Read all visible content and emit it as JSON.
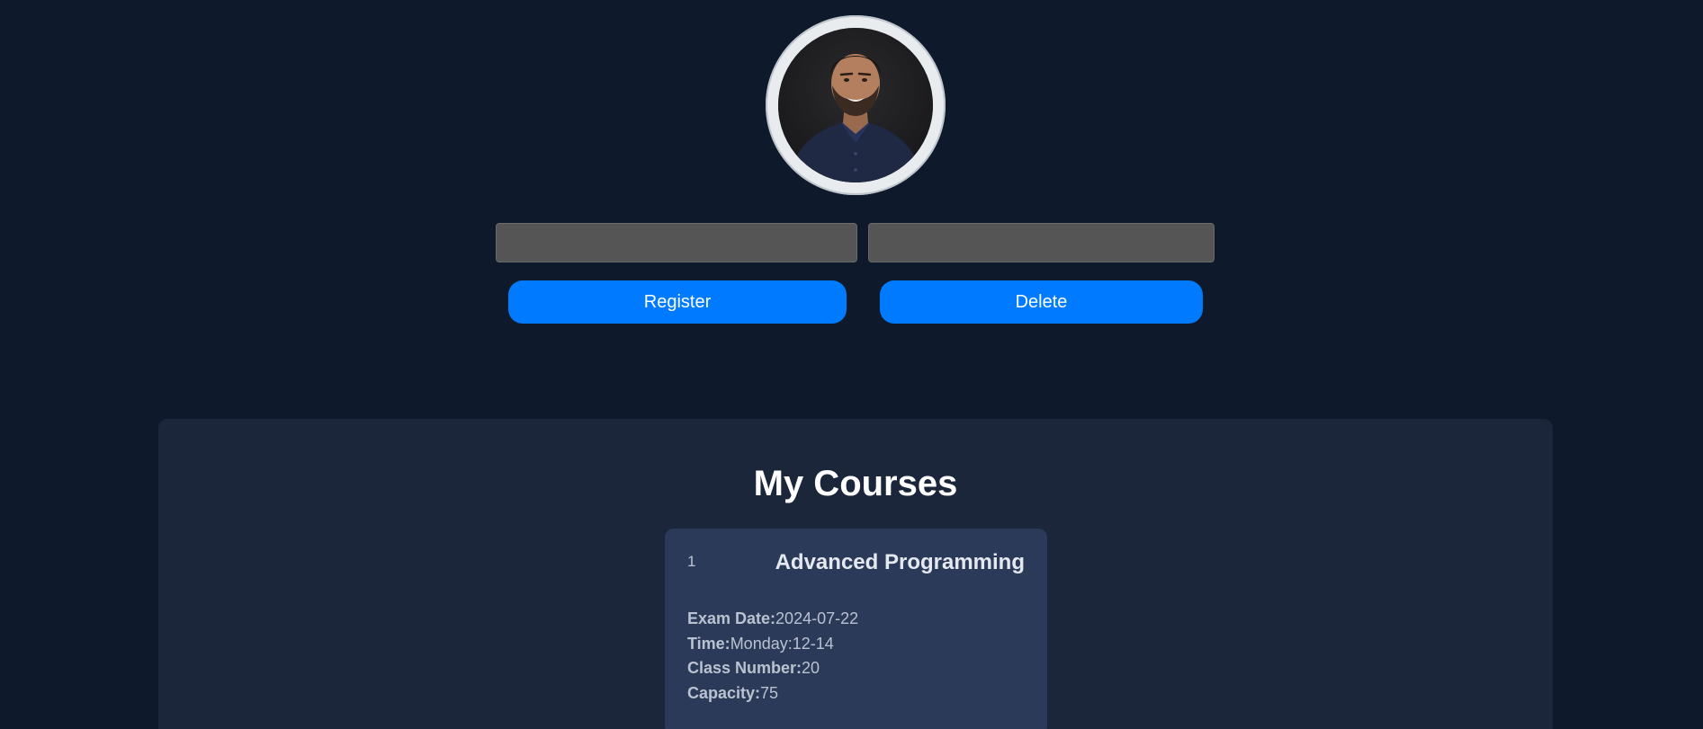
{
  "profile": {
    "photo_description": "profile-photo"
  },
  "form": {
    "field_one_value": "",
    "field_one_placeholder": "",
    "field_two_value": "",
    "field_two_placeholder": "",
    "register_label": "Register",
    "delete_label": "Delete"
  },
  "courses": {
    "title": "My Courses",
    "items": [
      {
        "index": "1",
        "name": "Advanced Programming",
        "exam_date_label": "Exam Date:",
        "exam_date": "2024-07-22",
        "time_label": "Time:",
        "time": "Monday:12-14",
        "class_number_label": "Class Number:",
        "class_number": "20",
        "capacity_label": "Capacity:",
        "capacity": "75"
      }
    ]
  },
  "colors": {
    "background": "#0e1a2b",
    "panel": "#1b263b",
    "card": "#2c3a5a",
    "accent": "#007bff",
    "input": "#555555"
  }
}
